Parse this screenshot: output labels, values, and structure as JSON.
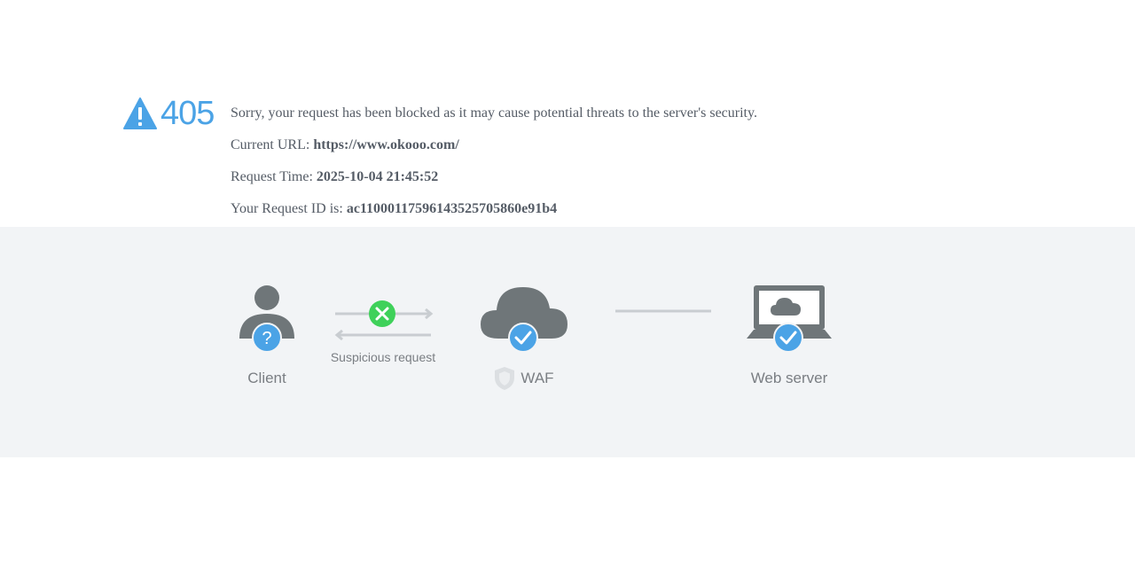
{
  "error": {
    "code": "405",
    "icon": "warning-triangle-icon",
    "message": "Sorry, your request has been blocked as it may cause potential threats to the server's security.",
    "url_label": "Current URL: ",
    "url_value": "https://www.okooo.com/",
    "time_label": "Request Time: ",
    "time_value": "2025-10-04 21:45:52",
    "id_label": "Your Request ID is: ",
    "id_value": "ac11000117596143525705860e91b4"
  },
  "diagram": {
    "client_label": "Client",
    "request_label": "Suspicious request",
    "waf_label": "WAF",
    "server_label": "Web server"
  },
  "colors": {
    "accent": "#4ba3e6",
    "block": "#3fd15a",
    "icon_gray": "#6f7679",
    "band": "#f2f4f6"
  }
}
